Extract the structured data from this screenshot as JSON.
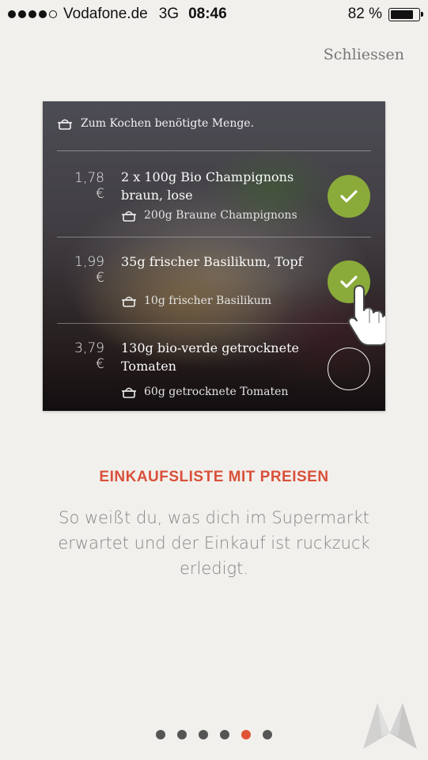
{
  "status_bar": {
    "carrier": "Vodafone.de",
    "network": "3G",
    "time": "08:46",
    "battery": "82 %",
    "battery_level": 0.82
  },
  "close_label": "Schliessen",
  "card": {
    "header": "Zum Kochen benötigte Menge.",
    "items": [
      {
        "price": "1,78 €",
        "title": "2 x 100g Bio Champignons braun, lose",
        "amount": "200g Braune Champignons",
        "checked": true
      },
      {
        "price": "1,99 €",
        "title": "35g frischer Basilikum, Topf",
        "amount": "10g frischer Basilikum",
        "checked": true
      },
      {
        "price": "3,79 €",
        "title": "130g bio-verde getrocknete Tomaten",
        "amount": "60g getrocknete Tomaten",
        "checked": false
      }
    ]
  },
  "headline": "EINKAUFSLISTE MIT PREISEN",
  "description": "So weißt du, was dich im Supermarkt erwartet und der Einkauf ist ruckzuck erledigt.",
  "pager": {
    "count": 6,
    "active_index": 4
  },
  "colors": {
    "accent": "#e05436",
    "check_green": "#8aab3a",
    "background": "#f2f0ec"
  }
}
